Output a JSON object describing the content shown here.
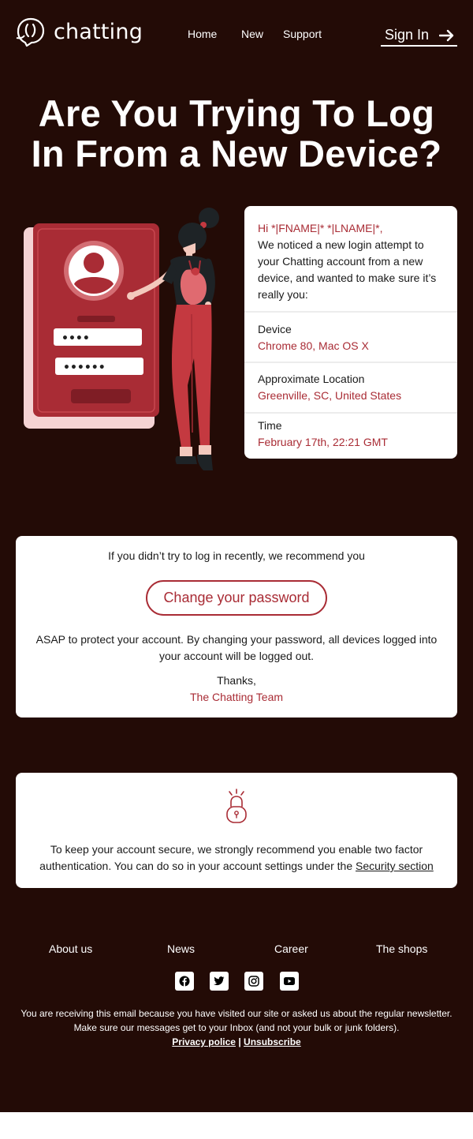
{
  "header": {
    "logo_text": "chatting",
    "nav": [
      "Home",
      "New",
      "Support"
    ],
    "signin_label": "Sign In"
  },
  "hero": {
    "title_line1": "Are You Trying To Log",
    "title_line2": "In From a New Device?"
  },
  "login_form_illustration": {
    "password_mask_1": "••••",
    "password_mask_2": "••••••"
  },
  "info_card": {
    "greeting": "Hi *|FNAME|* *|LNAME|*,",
    "message": "We noticed a new login attempt to your Chatting account from a new device, and wanted to make sure it’s really you:",
    "rows": [
      {
        "label": "Device",
        "value": "Chrome 80, Mac OS X"
      },
      {
        "label": "Approximate Location",
        "value": "Greenville, SC, United States"
      },
      {
        "label": "Time",
        "value": "February 17th, 22:21 GMT"
      }
    ]
  },
  "recommend": {
    "intro": "If you didn’t try to log in recently, we recommend you",
    "button": "Change your password",
    "body": "ASAP to protect your account. By changing your password, all devices logged into your account will be logged out.",
    "thanks": "Thanks,",
    "team": "The Chatting Team"
  },
  "security": {
    "text": "To keep your account secure, we strongly recommend you enable two factor authentication. You can do so in your account settings under the",
    "link": "Security section"
  },
  "footer": {
    "links": [
      "About us",
      "News",
      "Career",
      "The shops"
    ],
    "social_icons": [
      "facebook-icon",
      "twitter-icon",
      "instagram-icon",
      "youtube-icon"
    ],
    "note_line1": "You are receiving this email because you have visited our site or asked us about the regular newsletter.",
    "note_line2": "Make sure our messages get to your Inbox (and not your bulk or junk folders).",
    "privacy": "Privacy police",
    "separator": "|",
    "unsubscribe": "Unsubscribe"
  },
  "colors": {
    "background": "#230b06",
    "accent": "#a92c35",
    "card": "#ffffff"
  }
}
